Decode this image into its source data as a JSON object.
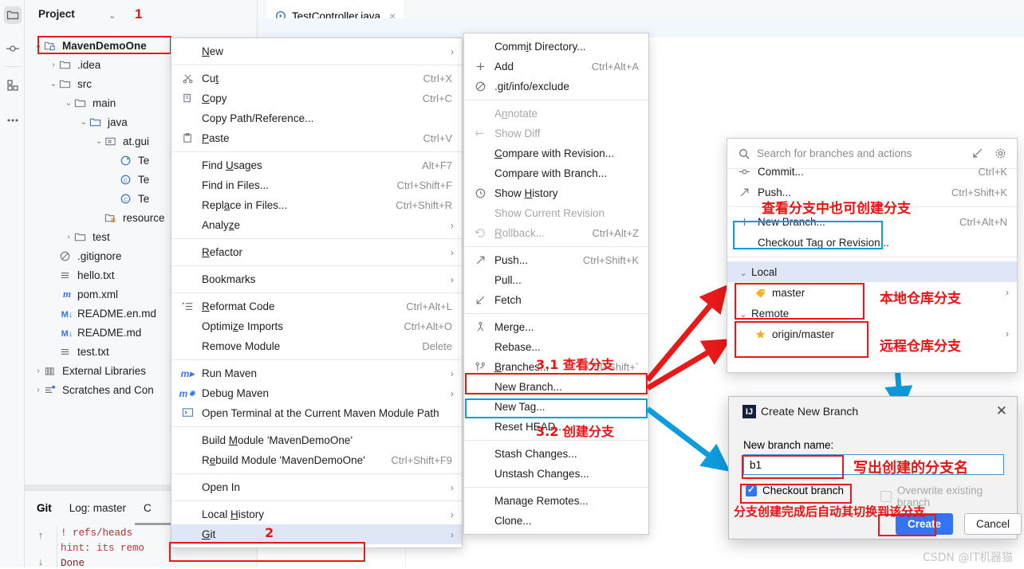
{
  "left_rail": {
    "items": [
      {
        "name": "project-tool-window",
        "icon": "folder-icon"
      },
      {
        "name": "commit-tool-window",
        "icon": "commit-icon"
      },
      {
        "name": "structure-tool-window",
        "icon": "structure-icon"
      },
      {
        "name": "more-tool-windows",
        "icon": "more-icon"
      }
    ]
  },
  "project": {
    "title": "Project",
    "annotation_step": "1",
    "tree": [
      {
        "label": "MavenDemoOne",
        "icon": "module-icon",
        "depth": 0,
        "twisty": "v",
        "bold": true
      },
      {
        "label": ".idea",
        "icon": "folder-icon",
        "depth": 1,
        "twisty": ">"
      },
      {
        "label": "src",
        "icon": "folder-icon",
        "depth": 1,
        "twisty": "v"
      },
      {
        "label": "main",
        "icon": "folder-icon",
        "depth": 2,
        "twisty": "v"
      },
      {
        "label": "java",
        "icon": "source-folder-icon",
        "depth": 3,
        "twisty": "v"
      },
      {
        "label": "at.gui",
        "icon": "package-icon",
        "depth": 4,
        "twisty": "v"
      },
      {
        "label": "Te",
        "icon": "class-run-icon",
        "depth": 5,
        "twisty": ""
      },
      {
        "label": "Te",
        "icon": "class-icon",
        "depth": 5,
        "twisty": ""
      },
      {
        "label": "Te",
        "icon": "class-icon",
        "depth": 5,
        "twisty": ""
      },
      {
        "label": "resource",
        "icon": "resources-folder-icon",
        "depth": 4,
        "twisty": ""
      },
      {
        "label": "test",
        "icon": "folder-icon",
        "depth": 2,
        "twisty": ">"
      },
      {
        "label": ".gitignore",
        "icon": "gitignore-icon",
        "depth": 1,
        "twisty": ""
      },
      {
        "label": "hello.txt",
        "icon": "text-file-icon",
        "depth": 1,
        "twisty": ""
      },
      {
        "label": "pom.xml",
        "icon": "maven-icon",
        "depth": 1,
        "twisty": ""
      },
      {
        "label": "README.en.md",
        "icon": "markdown-icon",
        "depth": 1,
        "twisty": ""
      },
      {
        "label": "README.md",
        "icon": "markdown-icon",
        "depth": 1,
        "twisty": ""
      },
      {
        "label": "test.txt",
        "icon": "text-file-icon",
        "depth": 1,
        "twisty": ""
      },
      {
        "label": "External Libraries",
        "icon": "library-icon",
        "depth": 0,
        "twisty": ">"
      },
      {
        "label": "Scratches and Con",
        "icon": "scratches-icon",
        "depth": 0,
        "twisty": ">"
      }
    ]
  },
  "editor": {
    "tab_label": "TestController.java",
    "tab_icon": "class-run-icon",
    "tab_close": "×"
  },
  "git_panel": {
    "tabs": [
      "Git",
      "Log: master",
      "C"
    ],
    "console_lines": [
      "!   refs/heads",
      "hint: its remo",
      "Done"
    ]
  },
  "context_menu": {
    "items": [
      {
        "label": "New",
        "mnemonic": "N",
        "icon": "",
        "shortcut": "",
        "submenu": true
      },
      {
        "sep": true
      },
      {
        "label": "Cut",
        "mnemonic": "t",
        "icon": "scissors-icon",
        "shortcut": "Ctrl+X"
      },
      {
        "label": "Copy",
        "mnemonic": "C",
        "icon": "copy-icon",
        "shortcut": "Ctrl+C"
      },
      {
        "label": "Copy Path/Reference...",
        "icon": "",
        "shortcut": ""
      },
      {
        "label": "Paste",
        "mnemonic": "P",
        "icon": "paste-icon",
        "shortcut": "Ctrl+V"
      },
      {
        "sep": true
      },
      {
        "label": "Find Usages",
        "mnemonic": "U",
        "icon": "",
        "shortcut": "Alt+F7"
      },
      {
        "label": "Find in Files...",
        "icon": "",
        "shortcut": "Ctrl+Shift+F"
      },
      {
        "label": "Replace in Files...",
        "mnemonic": "a",
        "icon": "",
        "shortcut": "Ctrl+Shift+R"
      },
      {
        "label": "Analyze",
        "mnemonic": "z",
        "icon": "",
        "shortcut": "",
        "submenu": true
      },
      {
        "sep": true
      },
      {
        "label": "Refactor",
        "mnemonic": "R",
        "icon": "",
        "shortcut": "",
        "submenu": true
      },
      {
        "sep": true
      },
      {
        "label": "Bookmarks",
        "icon": "",
        "shortcut": "",
        "submenu": true
      },
      {
        "sep": true
      },
      {
        "label": "Reformat Code",
        "mnemonic": "R",
        "icon": "reformat-icon",
        "shortcut": "Ctrl+Alt+L"
      },
      {
        "label": "Optimize Imports",
        "mnemonic": "z",
        "icon": "",
        "shortcut": "Ctrl+Alt+O"
      },
      {
        "label": "Remove Module",
        "icon": "",
        "shortcut": "Delete"
      },
      {
        "sep": true
      },
      {
        "label": "Run Maven",
        "icon": "maven-run-icon",
        "shortcut": "",
        "submenu": true
      },
      {
        "label": "Debug Maven",
        "icon": "maven-debug-icon",
        "shortcut": "",
        "submenu": true
      },
      {
        "label": "Open Terminal at the Current Maven Module Path",
        "icon": "terminal-icon",
        "shortcut": ""
      },
      {
        "sep": true
      },
      {
        "label": "Build Module 'MavenDemoOne'",
        "mnemonic": "M",
        "icon": "",
        "shortcut": ""
      },
      {
        "label": "Rebuild Module 'MavenDemoOne'",
        "mnemonic": "e",
        "icon": "",
        "shortcut": "Ctrl+Shift+F9"
      },
      {
        "sep": true
      },
      {
        "label": "Open In",
        "icon": "",
        "shortcut": "",
        "submenu": true
      },
      {
        "sep": true
      },
      {
        "label": "Local History",
        "mnemonic": "H",
        "icon": "",
        "shortcut": "",
        "submenu": true
      },
      {
        "label": "Git",
        "mnemonic": "G",
        "icon": "",
        "shortcut": "",
        "submenu": true,
        "selected": true
      }
    ],
    "annotation_step": "2"
  },
  "git_menu": {
    "items": [
      {
        "label": "Commit Directory...",
        "mnemonic": "i",
        "icon": "",
        "shortcut": ""
      },
      {
        "label": "Add",
        "icon": "plus-icon",
        "shortcut": "Ctrl+Alt+A"
      },
      {
        "label": ".git/info/exclude",
        "mnemonic": "g",
        "icon": "exclude-icon",
        "shortcut": ""
      },
      {
        "sep": true
      },
      {
        "label": "Annotate",
        "mnemonic": "n",
        "icon": "",
        "shortcut": "",
        "disabled": true
      },
      {
        "label": "Show Diff",
        "icon": "diff-icon",
        "shortcut": "",
        "disabled": true
      },
      {
        "label": "Compare with Revision...",
        "mnemonic": "C",
        "icon": "",
        "shortcut": ""
      },
      {
        "label": "Compare with Branch...",
        "icon": "",
        "shortcut": ""
      },
      {
        "label": "Show History",
        "mnemonic": "H",
        "icon": "clock-icon",
        "shortcut": ""
      },
      {
        "label": "Show Current Revision",
        "icon": "",
        "shortcut": "",
        "disabled": true
      },
      {
        "label": "Rollback...",
        "mnemonic": "R",
        "icon": "rollback-icon",
        "shortcut": "Ctrl+Alt+Z",
        "disabled": true
      },
      {
        "sep": true
      },
      {
        "label": "Push...",
        "icon": "push-icon",
        "shortcut": "Ctrl+Shift+K"
      },
      {
        "label": "Pull...",
        "icon": "",
        "shortcut": ""
      },
      {
        "label": "Fetch",
        "icon": "fetch-icon",
        "shortcut": ""
      },
      {
        "sep": true
      },
      {
        "label": "Merge...",
        "icon": "merge-icon",
        "shortcut": ""
      },
      {
        "label": "Rebase...",
        "icon": "",
        "shortcut": ""
      },
      {
        "label": "Branches...",
        "mnemonic": "B",
        "icon": "branch-icon",
        "shortcut": "Ctrl+Shift+`"
      },
      {
        "label": "New Branch...",
        "icon": "",
        "shortcut": ""
      },
      {
        "label": "New Tag...",
        "icon": "",
        "shortcut": ""
      },
      {
        "label": "Reset HEAD...",
        "icon": "",
        "shortcut": ""
      },
      {
        "sep": true
      },
      {
        "label": "Stash Changes...",
        "icon": "",
        "shortcut": ""
      },
      {
        "label": "Unstash Changes...",
        "icon": "",
        "shortcut": ""
      },
      {
        "sep": true
      },
      {
        "label": "Manage Remotes...",
        "icon": "",
        "shortcut": ""
      },
      {
        "label": "Clone...",
        "icon": "",
        "shortcut": ""
      }
    ]
  },
  "branches_popup": {
    "search_placeholder": "Search for branches and actions",
    "expand_icon": "expand-icon",
    "settings_icon": "gear-icon",
    "items": [
      {
        "label": "Commit...",
        "icon": "commit-icon",
        "shortcut": "Ctrl+K",
        "clipped": true
      },
      {
        "label": "Push...",
        "icon": "push-icon",
        "shortcut": "Ctrl+Shift+K"
      },
      {
        "sep": true
      },
      {
        "label": "New Branch...",
        "icon": "plus-icon",
        "shortcut": "Ctrl+Alt+N"
      },
      {
        "label": "Checkout Tag or Revision...",
        "icon": "",
        "shortcut": ""
      },
      {
        "sep": true
      },
      {
        "label": "Local",
        "icon": "chevron-down-icon",
        "group": true,
        "highlight": true
      },
      {
        "label": "master",
        "icon": "branch-tag-icon",
        "indent": true,
        "arrow": true
      },
      {
        "label": "Remote",
        "icon": "chevron-down-icon",
        "group": true
      },
      {
        "label": "origin/master",
        "icon": "star-icon",
        "indent": true,
        "arrow": true
      }
    ]
  },
  "create_branch_dialog": {
    "title": "Create New Branch",
    "icon": "intellij-icon",
    "close": "✕",
    "field_label": "New branch name:",
    "branch_name": "b1",
    "checkout_label": "Checkout branch",
    "checkout_checked": true,
    "overwrite_label": "Overwrite existing branch",
    "overwrite_checked": false,
    "create_button": "Create",
    "cancel_button": "Cancel"
  },
  "annotations": {
    "step1": "1",
    "step2": "2",
    "step31": "3.1 查看分支",
    "step32": "3.2 创建分支",
    "branches_note": "查看分支中也可创建分支",
    "local_note": "本地仓库分支",
    "remote_note": "远程仓库分支",
    "name_note": "写出创建的分支名",
    "checkout_note": "分支创建完成后自动其切换到该分支"
  },
  "watermark": "CSDN @IT机器猫",
  "colors": {
    "accent_blue": "#3574f0",
    "annotation_red": "#ee1111",
    "annotation_blue": "#0d9cde",
    "selection": "#dfe7f7",
    "panel_bg": "#f7f8fa"
  }
}
